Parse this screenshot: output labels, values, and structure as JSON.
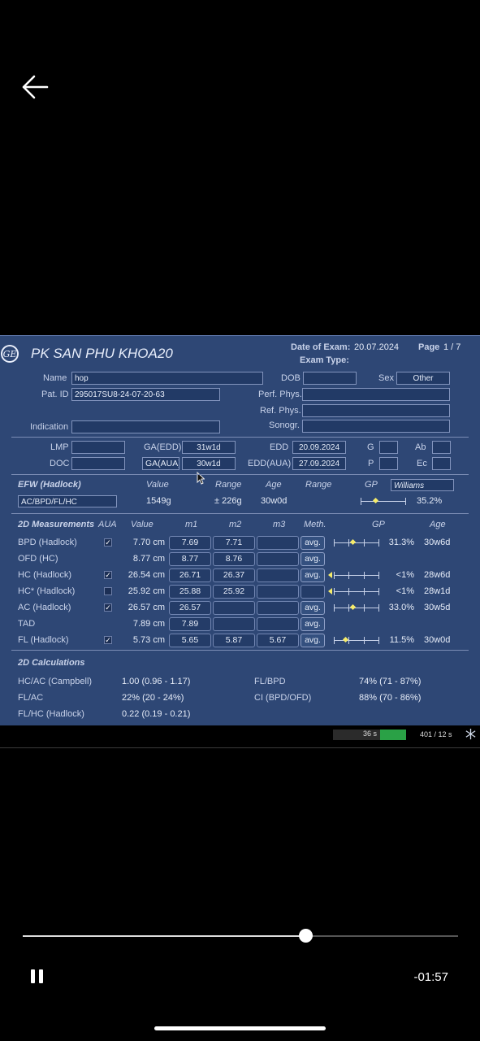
{
  "player": {
    "back_icon": "arrow-left-icon",
    "progress": 0.65,
    "remaining": "-01:57"
  },
  "header": {
    "clinic": "PK SAN PHU  KHOA20",
    "date_label": "Date of Exam:",
    "date": "20.07.2024",
    "page_label": "Page",
    "page": "1 / 7",
    "exam_type_label": "Exam Type:"
  },
  "patient": {
    "name_label": "Name",
    "name": "hop",
    "dob_label": "DOB",
    "dob": "",
    "sex_label": "Sex",
    "sex": "Other",
    "patid_label": "Pat. ID",
    "patid": "295017SU8-24-07-20-63",
    "perf_label": "Perf. Phys.",
    "ref_label": "Ref. Phys.",
    "indication_label": "Indication",
    "sonogr_label": "Sonogr."
  },
  "dates": {
    "lmp_label": "LMP",
    "doc_label": "DOC",
    "ga_edd_label": "GA(EDD)",
    "ga_edd": "31w1d",
    "ga_aua_label": "GA(AUA)",
    "ga_aua": "30w1d",
    "edd_label": "EDD",
    "edd": "20.09.2024",
    "edd_aua_label": "EDD(AUA)",
    "edd_aua": "27.09.2024",
    "g_label": "G",
    "p_label": "P",
    "ab_label": "Ab",
    "ec_label": "Ec"
  },
  "efw": {
    "title": "EFW (Hadlock)",
    "value_h": "Value",
    "range_h": "Range",
    "age_h": "Age",
    "range2_h": "Range",
    "gp_h": "GP",
    "gp_method": "Williams",
    "formula": "AC/BPD/FL/HC",
    "value": "1549g",
    "range": "± 226g",
    "age": "30w0d",
    "gp": "35.2%"
  },
  "meas_headers": {
    "title": "2D Measurements",
    "aua": "AUA",
    "value": "Value",
    "m1": "m1",
    "m2": "m2",
    "m3": "m3",
    "meth": "Meth.",
    "gp": "GP",
    "age": "Age"
  },
  "measurements": [
    {
      "name": "BPD (Hadlock)",
      "aua": "checked",
      "value": "7.70 cm",
      "m1": "7.69",
      "m2": "7.71",
      "m3": "",
      "meth": "avg.",
      "gp": "31.3%",
      "age": "30w6d"
    },
    {
      "name": "OFD (HC)",
      "aua": "",
      "value": "8.77 cm",
      "m1": "8.77",
      "m2": "8.76",
      "m3": "",
      "meth": "avg.",
      "gp": "",
      "age": ""
    },
    {
      "name": "HC (Hadlock)",
      "aua": "checked",
      "value": "26.54 cm",
      "m1": "26.71",
      "m2": "26.37",
      "m3": "",
      "meth": "avg.",
      "gp": "<1%",
      "age": "28w6d"
    },
    {
      "name": "HC* (Hadlock)",
      "aua": "unchecked",
      "value": "25.92 cm",
      "m1": "25.88",
      "m2": "25.92",
      "m3": "",
      "meth": "",
      "gp": "<1%",
      "age": "28w1d"
    },
    {
      "name": "AC (Hadlock)",
      "aua": "checked",
      "value": "26.57 cm",
      "m1": "26.57",
      "m2": "",
      "m3": "",
      "meth": "avg.",
      "gp": "33.0%",
      "age": "30w5d"
    },
    {
      "name": "TAD",
      "aua": "",
      "value": "7.89 cm",
      "m1": "7.89",
      "m2": "",
      "m3": "",
      "meth": "avg.",
      "gp": "",
      "age": ""
    },
    {
      "name": "FL (Hadlock)",
      "aua": "checked",
      "value": "5.73 cm",
      "m1": "5.65",
      "m2": "5.87",
      "m3": "5.67",
      "meth": "avg.",
      "gp": "11.5%",
      "age": "30w0d"
    }
  ],
  "calc": {
    "title": "2D Calculations",
    "hcac_label": "HC/AC (Campbell)",
    "hcac": "1.00 (0.96 - 1.17)",
    "flac_label": "FL/AC",
    "flac": "22% (20 - 24%)",
    "flhc_label": "FL/HC (Hadlock)",
    "flhc": "0.22 (0.19 - 0.21)",
    "flbpd_label": "FL/BPD",
    "flbpd": "74% (71 - 87%)",
    "ci_label": "CI (BPD/OFD)",
    "ci": "88% (70 - 86%)"
  },
  "status": {
    "cine_time": "36 s",
    "frames": "401 / 12 s",
    "freeze_icon": "snowflake-icon"
  }
}
